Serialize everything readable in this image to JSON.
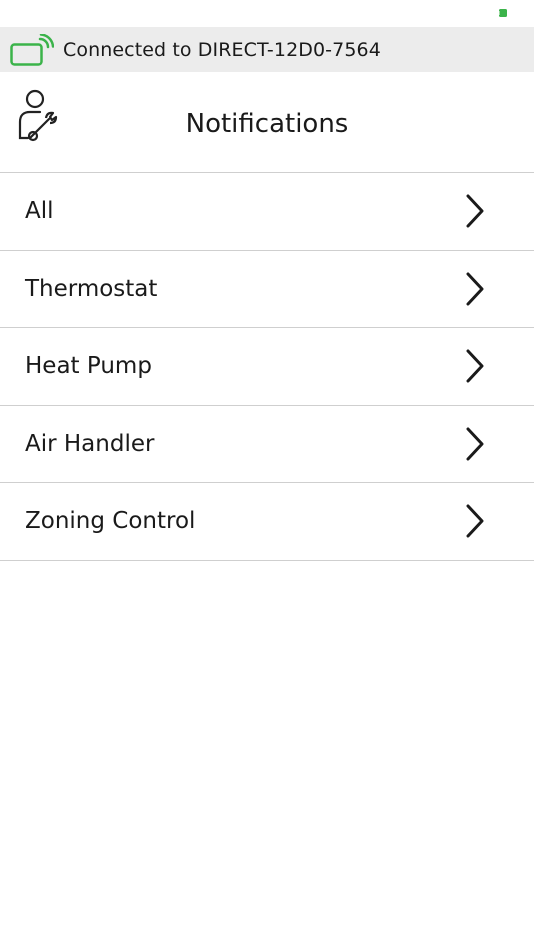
{
  "status_bar": {
    "battery_icon": "battery-icon",
    "battery_color": "#3bb34a"
  },
  "connection": {
    "icon": "wifi-device-icon",
    "text": "Connected to DIRECT-12D0-7564",
    "accent_color": "#3bb34a"
  },
  "header": {
    "icon": "technician-icon",
    "title": "Notifications"
  },
  "menu": {
    "items": [
      {
        "label": "All",
        "icon": "chevron-right-icon"
      },
      {
        "label": "Thermostat",
        "icon": "chevron-right-icon"
      },
      {
        "label": "Heat Pump",
        "icon": "chevron-right-icon"
      },
      {
        "label": "Air Handler",
        "icon": "chevron-right-icon"
      },
      {
        "label": "Zoning Control",
        "icon": "chevron-right-icon"
      }
    ]
  }
}
